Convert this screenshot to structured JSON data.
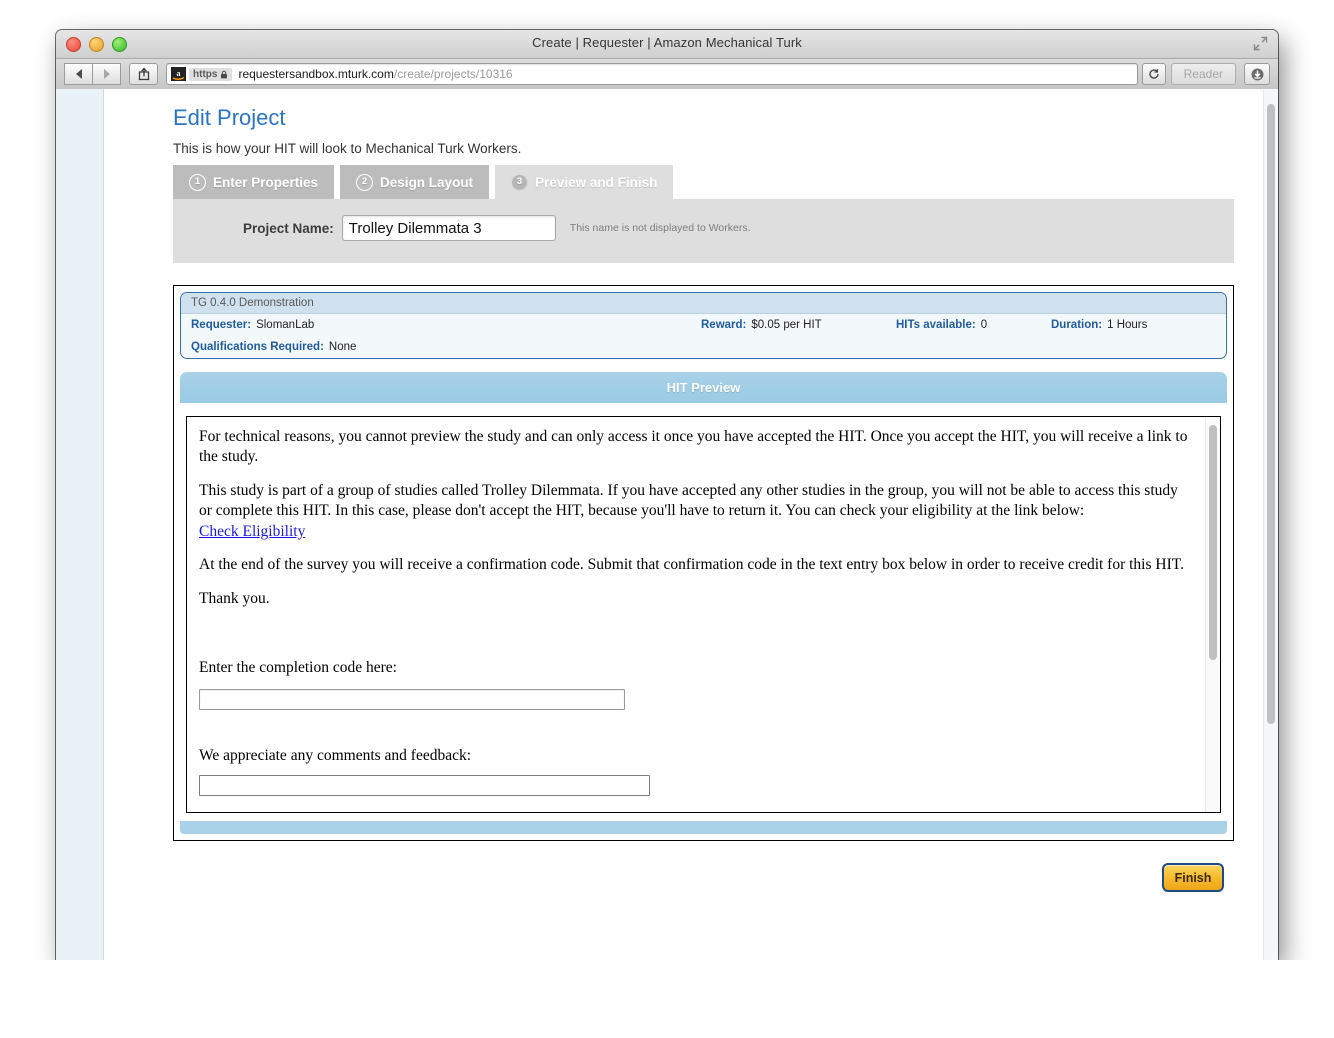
{
  "window": {
    "title": "Create | Requester | Amazon Mechanical Turk",
    "controls": {
      "close": "close-window",
      "minimize": "minimize-window",
      "maximize": "maximize-window"
    },
    "fullscreen_icon": "fullscreen-icon"
  },
  "toolbar": {
    "back_icon": "back-arrow-icon",
    "forward_icon": "forward-arrow-icon",
    "share_icon": "share-icon",
    "favicon": "amazon-favicon",
    "https_label": "https",
    "lock_icon": "lock-icon",
    "url_domain": "requestersandbox.mturk.com",
    "url_path": "/create/projects/10316",
    "reload_icon": "reload-icon",
    "reader_label": "Reader",
    "downloads_icon": "downloads-icon"
  },
  "page": {
    "title": "Edit Project",
    "subtitle": "This is how your HIT will look to Mechanical Turk Workers.",
    "tabs": [
      {
        "num": "1",
        "label": "Enter Properties",
        "active": false
      },
      {
        "num": "2",
        "label": "Design Layout",
        "active": false
      },
      {
        "num": "3",
        "label": "Preview and Finish",
        "active": true
      }
    ],
    "project_name": {
      "label": "Project Name:",
      "value": "Trolley Dilemmata 3",
      "placeholder": "",
      "hint": "This name is not displayed to Workers."
    },
    "hit_info": {
      "title": "TG 0.4.0 Demonstration",
      "requester_label": "Requester:",
      "requester_value": "SlomanLab",
      "reward_label": "Reward:",
      "reward_value": "$0.05 per HIT",
      "hits_label": "HITs available:",
      "hits_value": "0",
      "duration_label": "Duration:",
      "duration_value": "1 Hours",
      "qualifications_label": "Qualifications Required:",
      "qualifications_value": "None"
    },
    "preview_bar_title": "HIT Preview",
    "hit_body": {
      "paragraph1": "For technical reasons, you cannot preview the study and can only access it once you have accepted the HIT. Once you accept the HIT, you will receive a link to the study.",
      "paragraph2": "This study is part of a group of studies called Trolley Dilemmata. If you have accepted any other studies in the group, you will not be able to access this study or complete this HIT. In this case, please don't accept the HIT, because you'll have to return it. You can check your eligibility at the link below:",
      "eligibility_link": "Check Eligibility",
      "paragraph3": "At the end of the survey you will receive a confirmation code. Submit that confirmation code in the text entry box below in order to receive credit for this HIT.",
      "paragraph4": "Thank you.",
      "completion_code_label": "Enter the completion code here:",
      "completion_code_value": "",
      "feedback_label": "We appreciate any comments and feedback:",
      "feedback_value": ""
    },
    "finish_label": "Finish"
  },
  "colors": {
    "page_title": "#2b73c4",
    "tab_inactive": "#bcbcbc",
    "tab_active": "#dedede",
    "panel_gray": "#dedede",
    "preview_blue": "#a9d2e8",
    "info_border_blue": "#3b6fa5",
    "link_blue": "#1a1ae0",
    "finish_gold": "#f6bc2c",
    "finish_border": "#1c4b86",
    "left_margin": "#e9f2f7"
  }
}
